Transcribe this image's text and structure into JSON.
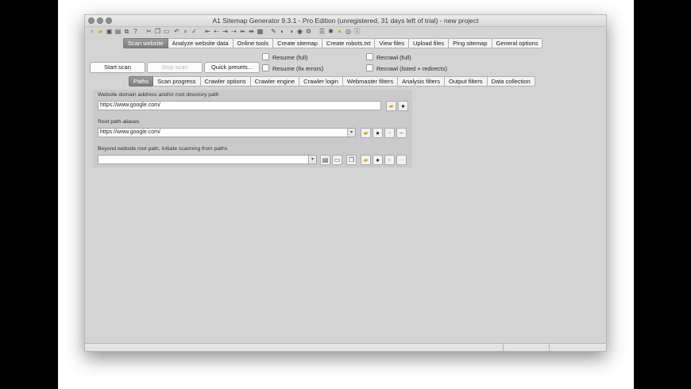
{
  "window": {
    "title": "A1 Sitemap Generator 9.3.1 - Pro Edition (unregistered, 31 days left of trial) - new project"
  },
  "toolbar_icons": [
    "new-file-icon",
    "open-folder-icon",
    "save-icon",
    "save-as-icon",
    "copy-project-icon",
    "help-icon",
    "cut-icon",
    "copy-icon",
    "paste-icon",
    "undo-icon",
    "search-icon",
    "spell-check-icon",
    "indent-left-icon",
    "outdent-icon",
    "indent-right-icon",
    "move-right-icon",
    "move-left-icon",
    "split-icon",
    "grid-icon",
    "brush-icon",
    "globe-back-icon",
    "globe-forward-icon",
    "globe-icon",
    "gear-icon",
    "list-icon",
    "tools-icon",
    "bulb-icon",
    "pointer-icon"
  ],
  "main_tabs": [
    {
      "label": "Scan website",
      "active": true
    },
    {
      "label": "Analyze website data",
      "active": false
    },
    {
      "label": "Online tools",
      "active": false
    },
    {
      "label": "Create sitemap",
      "active": false
    },
    {
      "label": "Create robots.txt",
      "active": false
    },
    {
      "label": "View files",
      "active": false
    },
    {
      "label": "Upload files",
      "active": false
    },
    {
      "label": "Ping sitemap",
      "active": false
    },
    {
      "label": "General options",
      "active": false
    }
  ],
  "scan_controls": {
    "start_label": "Start scan",
    "stop_label": "Stop scan",
    "presets_label": "Quick presets...",
    "resume_full": "Resume (full)",
    "resume_fix": "Resume (fix errors)",
    "recrawl_full": "Recrawl (full)",
    "recrawl_listed": "Recrawl (listed + redirects)"
  },
  "sub_tabs": [
    {
      "label": "Paths",
      "active": true
    },
    {
      "label": "Scan progress",
      "active": false
    },
    {
      "label": "Crawler options",
      "active": false
    },
    {
      "label": "Crawler engine",
      "active": false
    },
    {
      "label": "Crawler login",
      "active": false
    },
    {
      "label": "Webmaster filters",
      "active": false
    },
    {
      "label": "Analysis filters",
      "active": false
    },
    {
      "label": "Output filters",
      "active": false
    },
    {
      "label": "Data collection",
      "active": false
    }
  ],
  "paths": {
    "domain_label": "Website domain address and/or root directory path",
    "domain_value": "https://www.google.com/",
    "alias_label": "Root path aliases",
    "alias_value": "https://www.google.com/",
    "beyond_label": "Beyond website root path, initiate scanning from paths",
    "beyond_value": ""
  },
  "colors": {
    "active_tab": "#8a8a8a",
    "window_bg": "#d4d4d4",
    "folder": "#d8a623"
  }
}
